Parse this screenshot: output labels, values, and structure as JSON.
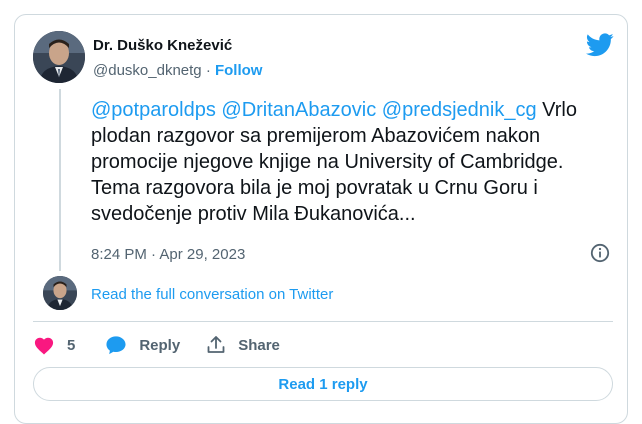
{
  "author": {
    "name": "Dr. Duško Knežević",
    "handle": "@dusko_dknetg",
    "separator": "·",
    "follow_label": "Follow"
  },
  "tweet": {
    "mentions": [
      "@potparoldps",
      "@DritanAbazovic",
      "@predsjednik_cg"
    ],
    "body": "Vrlo plodan razgovor sa premijerom Abazovićem nakon promocije njegove knjige na University of Cambridge. Tema razgovora bila je moj povratak u Crnu Goru i svedočenje protiv Mila Đukanovića...",
    "time": "8:24 PM",
    "date": "Apr 29, 2023"
  },
  "conversation_link": "Read the full conversation on Twitter",
  "actions": {
    "like_count": "5",
    "reply_label": "Reply",
    "share_label": "Share"
  },
  "read_replies_label": "Read 1 reply",
  "icons": {
    "brand": "twitter-bird-icon",
    "info": "info-icon",
    "like": "heart-icon",
    "reply": "reply-bubble-icon",
    "share": "share-upload-icon"
  },
  "colors": {
    "accent": "#1d9bf0",
    "like": "#f91880",
    "text": "#0f1419",
    "secondary": "#536471",
    "border": "#cfd9de"
  }
}
